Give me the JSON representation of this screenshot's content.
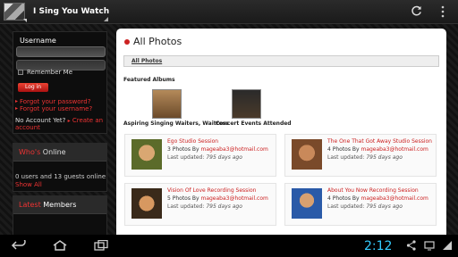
{
  "app": {
    "title": "I Sing You Watch"
  },
  "sidebar": {
    "username_label": "Username",
    "remember_label": "Remember Me",
    "login_label": "Log in",
    "forgot_password": "Forgot your password?",
    "forgot_username": "Forgot your username?",
    "no_account": "No Account Yet?",
    "create_account_1": "Create an",
    "create_account_2": "account",
    "online": {
      "title_a": "Who's",
      "title_b": "Online",
      "text": "0 users and 13 guests online",
      "show_all": "Show All"
    },
    "members": {
      "title_a": "Latest",
      "title_b": "Members"
    }
  },
  "main": {
    "page_title": "All Photos",
    "tab_label": "All Photos",
    "featured_label": "Featured Albums",
    "featured": [
      {
        "caption": "Aspiring Singing Waiters, Waitress"
      },
      {
        "caption": "Concert Events Attended"
      }
    ],
    "cards": [
      {
        "title": "Ego Studio Session",
        "meta_prefix": "3 Photos By",
        "email": "mageaba3@hotmail.com",
        "updated_prefix": "Last updated:",
        "updated": "795 days ago"
      },
      {
        "title": "The One That Got Away Studio Session",
        "meta_prefix": "4 Photos By",
        "email": "mageaba3@hotmail.com",
        "updated_prefix": "Last updated:",
        "updated": "795 days ago"
      },
      {
        "title": "Vision Of Love Recording Session",
        "meta_prefix": "5 Photos By",
        "email": "mageaba3@hotmail.com",
        "updated_prefix": "Last updated:",
        "updated": "795 days ago"
      },
      {
        "title": "About You Now Recording Session",
        "meta_prefix": "4 Photos By",
        "email": "mageaba3@hotmail.com",
        "updated_prefix": "Last updated:",
        "updated": "795 days ago"
      }
    ]
  },
  "system": {
    "clock": "2:12"
  },
  "colors": {
    "accent": "#cc2222",
    "clock": "#33ccff"
  }
}
